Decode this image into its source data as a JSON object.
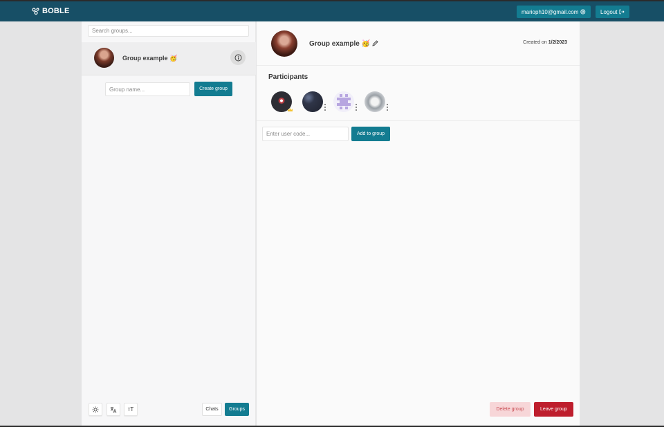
{
  "app": {
    "brand": "BOBLE",
    "user_email": "marioph10@gmail.com",
    "logout_label": "Logout"
  },
  "sidebar": {
    "search_placeholder": "Search groups...",
    "groups": [
      {
        "name": "Group example 🥳"
      }
    ],
    "new_group_placeholder": "Group name...",
    "create_group_label": "Create group",
    "tools": {
      "theme_icon": "sun-icon",
      "language_icon": "translate-icon",
      "font_size_label": "тT"
    },
    "tabs": {
      "chats_label": "Chats",
      "groups_label": "Groups",
      "active": "Groups"
    }
  },
  "main": {
    "group_title": "Group example 🥳",
    "created_prefix": "Created on ",
    "created_date": "1/2/2023",
    "participants_label": "Participants",
    "user_code_placeholder": "Enter user code...",
    "add_to_group_label": "Add to group",
    "delete_group_label": "Delete group",
    "leave_group_label": "Leave group"
  },
  "colors": {
    "topbar": "#174f66",
    "primary": "#137c91",
    "danger": "#be1e2d",
    "danger_light": "#f7d6d8"
  }
}
